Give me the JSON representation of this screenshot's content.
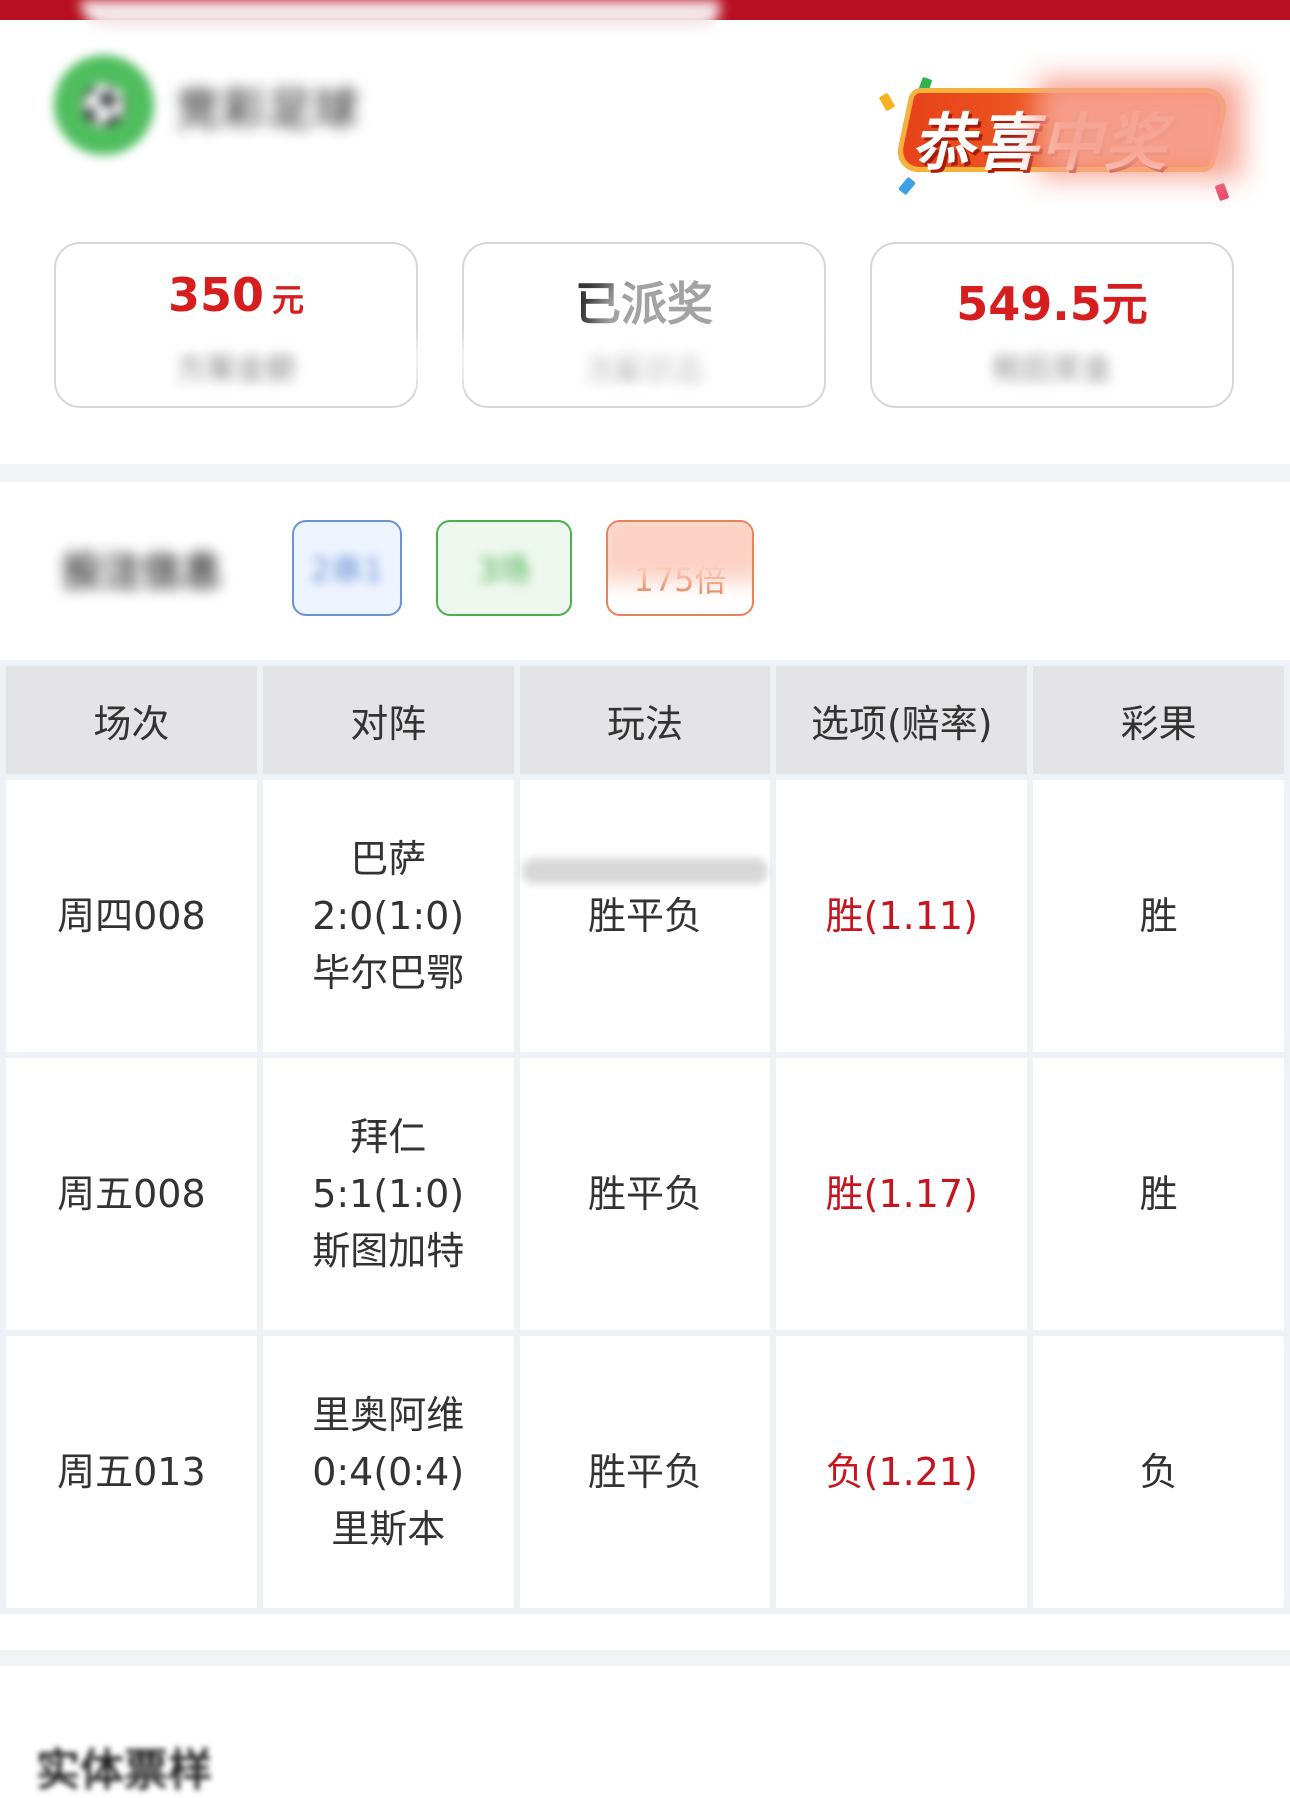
{
  "header": {
    "brand_name": "竞彩足球",
    "logo_icon": "football-icon",
    "banner_text": "恭喜中奖"
  },
  "stats": [
    {
      "value": "350",
      "unit": "元",
      "label": "方案金额"
    },
    {
      "value": "已派奖",
      "unit": "",
      "label": "方案状态"
    },
    {
      "value": "549.5元",
      "unit": "",
      "label": "税后奖金"
    }
  ],
  "plan": {
    "title": "投注信息",
    "tags": [
      "2串1",
      "3场",
      "175倍"
    ]
  },
  "table": {
    "headers": [
      "场次",
      "对阵",
      "玩法",
      "选项(赔率)",
      "彩果"
    ],
    "rows": [
      {
        "match_no": "周四008",
        "home": "巴萨",
        "score": "2:0(1:0)",
        "away": "毕尔巴鄂",
        "play": "胜平负",
        "pick": "胜(1.11)",
        "result": "胜"
      },
      {
        "match_no": "周五008",
        "home": "拜仁",
        "score": "5:1(1:0)",
        "away": "斯图加特",
        "play": "胜平负",
        "pick": "胜(1.17)",
        "result": "胜"
      },
      {
        "match_no": "周五013",
        "home": "里奥阿维",
        "score": "0:4(0:4)",
        "away": "里斯本",
        "play": "胜平负",
        "pick": "负(1.21)",
        "result": "负"
      }
    ]
  },
  "footer": {
    "section_title": "实体票样"
  },
  "colors": {
    "accent_red": "#c8141e",
    "top_bar": "#b80f22"
  }
}
